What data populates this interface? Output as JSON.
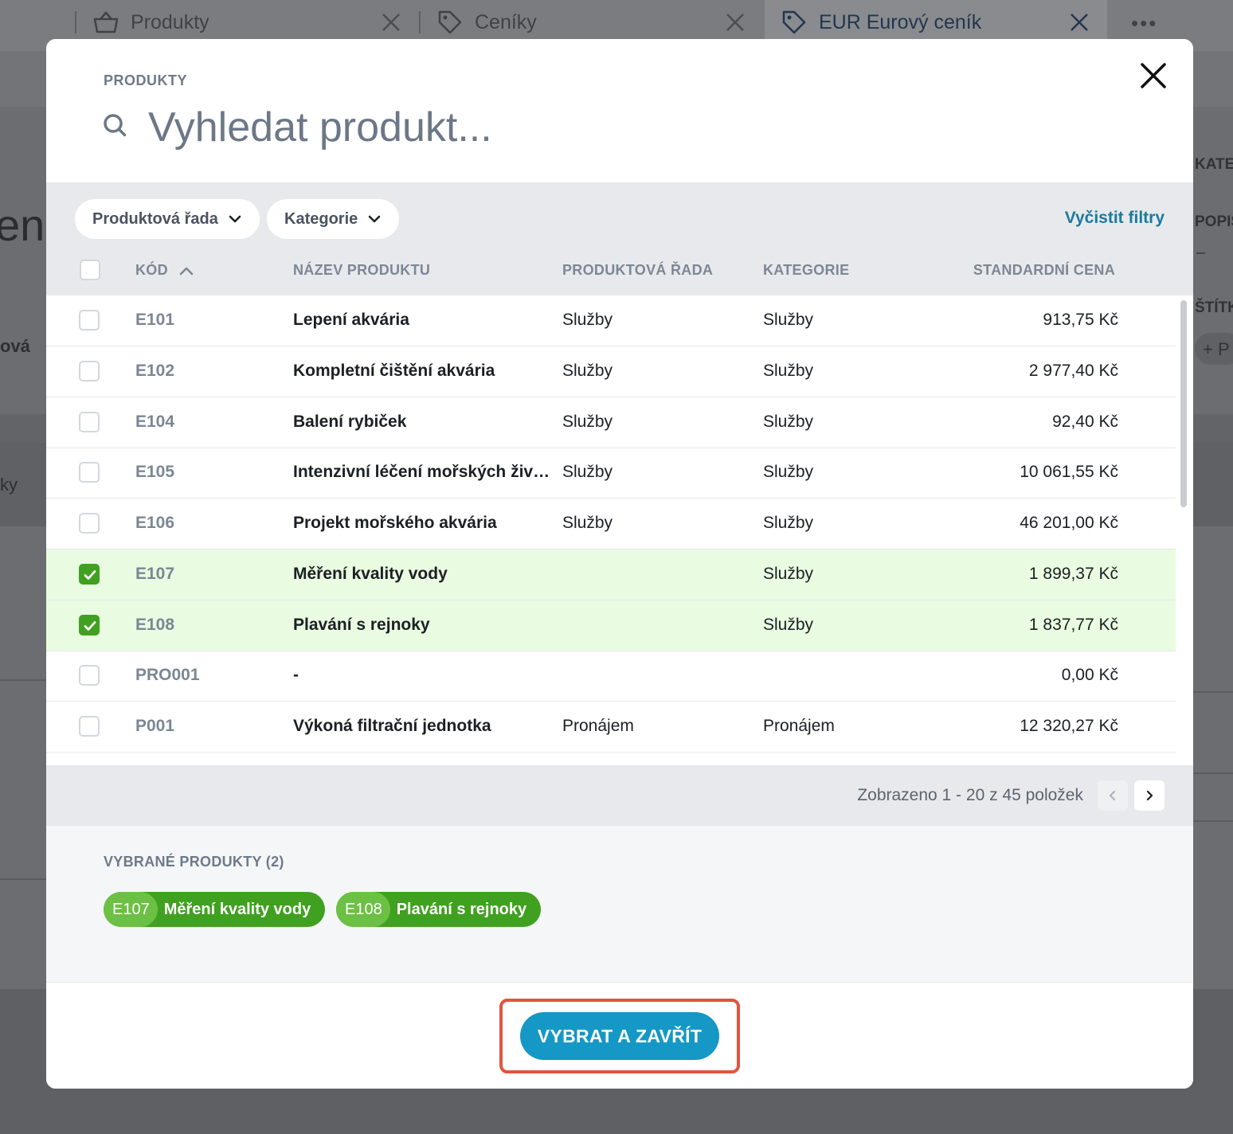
{
  "background": {
    "tabs": [
      {
        "label": "Produkty",
        "icon": "basket-icon"
      },
      {
        "label": "Ceníky",
        "icon": "tag-icon"
      },
      {
        "label": "EUR Eurový ceník",
        "icon": "tag-icon",
        "active": true
      }
    ],
    "more_label": "•••",
    "left_fragments": [
      "eni",
      "ová",
      "ky"
    ],
    "right_fragments": [
      "KATEG",
      "POPIS",
      "–",
      "ŠTÍTK",
      "+ P"
    ]
  },
  "modal": {
    "label": "PRODUKTY",
    "search_placeholder": "Vyhledat produkt...",
    "filters": {
      "product_line": "Produktová řada",
      "category": "Kategorie",
      "clear": "Vyčistit filtry"
    },
    "columns": {
      "code": "KÓD",
      "name": "NÁZEV PRODUKTU",
      "line": "PRODUKTOVÁ ŘADA",
      "category": "KATEGORIE",
      "price": "STANDARDNÍ CENA"
    },
    "rows": [
      {
        "code": "E101",
        "name": "Lepení akvária",
        "line": "Služby",
        "category": "Služby",
        "price": "913,75 Kč",
        "selected": false
      },
      {
        "code": "E102",
        "name": "Kompletní čištění akvária",
        "line": "Služby",
        "category": "Služby",
        "price": "2 977,40 Kč",
        "selected": false
      },
      {
        "code": "E104",
        "name": "Balení rybiček",
        "line": "Služby",
        "category": "Služby",
        "price": "92,40 Kč",
        "selected": false
      },
      {
        "code": "E105",
        "name": "Intenzivní léčení mořských živočichů",
        "line": "Služby",
        "category": "Služby",
        "price": "10 061,55 Kč",
        "selected": false
      },
      {
        "code": "E106",
        "name": "Projekt mořského akvária",
        "line": "Služby",
        "category": "Služby",
        "price": "46 201,00 Kč",
        "selected": false
      },
      {
        "code": "E107",
        "name": "Měření kvality vody",
        "line": "",
        "category": "Služby",
        "price": "1 899,37 Kč",
        "selected": true
      },
      {
        "code": "E108",
        "name": "Plavání s rejnoky",
        "line": "",
        "category": "Služby",
        "price": "1 837,77 Kč",
        "selected": true
      },
      {
        "code": "PRO001",
        "name": "-",
        "line": "",
        "category": "",
        "price": "0,00 Kč",
        "selected": false
      },
      {
        "code": "P001",
        "name": "Výkoná filtrační jednotka",
        "line": "Pronájem",
        "category": "Pronájem",
        "price": "12 320,27 Kč",
        "selected": false
      }
    ],
    "pager": {
      "text": "Zobrazeno 1 - 20 z 45 položek"
    },
    "selected": {
      "title": "VYBRANÉ PRODUKTY (2)",
      "chips": [
        {
          "code": "E107",
          "name": "Měření kvality vody"
        },
        {
          "code": "E108",
          "name": "Plavání s rejnoky"
        }
      ]
    },
    "submit_label": "VYBRAT A ZAVŘÍT"
  },
  "colors": {
    "accent": "#1598c5",
    "selected_green": "#3fa11f",
    "selected_row_bg": "#e9fbe0",
    "highlight": "#e0553f"
  }
}
